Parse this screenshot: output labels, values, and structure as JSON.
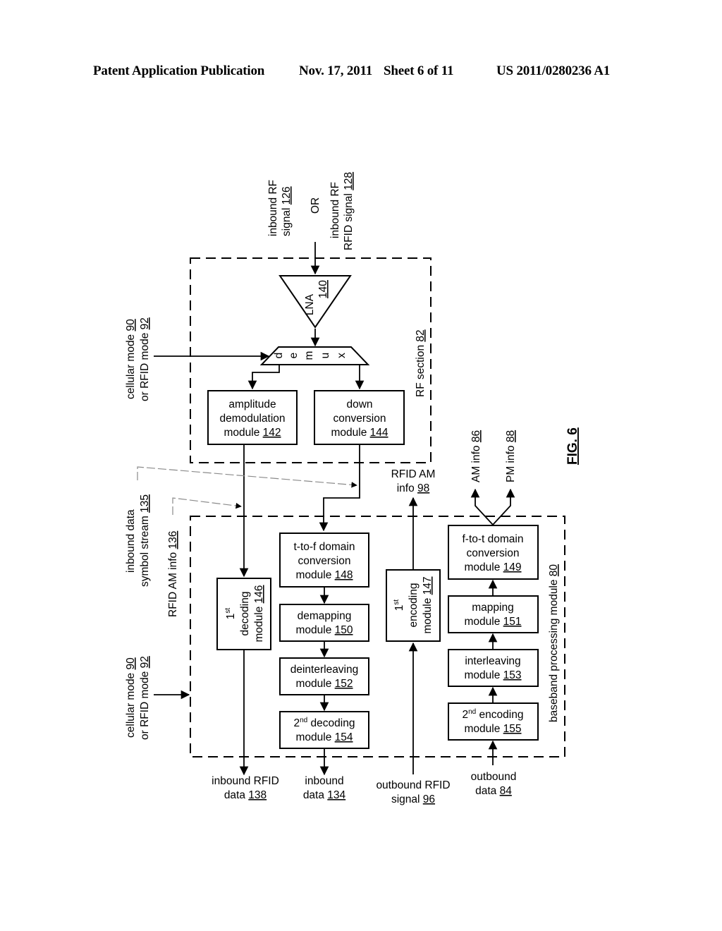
{
  "header": {
    "publication": "Patent Application Publication",
    "date": "Nov. 17, 2011",
    "sheet": "Sheet 6 of 11",
    "number": "US 2011/0280236 A1"
  },
  "figure": {
    "label": "FIG. 6",
    "inputs": {
      "inbound_rf": {
        "line1": "inbound RF",
        "line2_text": "signal ",
        "ref": "126"
      },
      "or": "OR",
      "inbound_rfid": {
        "line1": "inbound RF",
        "line2_text": "RFID signal ",
        "ref": "128"
      },
      "mode_top": {
        "line1_text": "cellular mode ",
        "ref1": "90",
        "line2_text": "or RFID mode ",
        "ref2": "92"
      },
      "mode_bottom": {
        "line1_text": "cellular mode ",
        "ref1": "90",
        "line2_text": "or RFID mode ",
        "ref2": "92"
      }
    },
    "rf_section": {
      "label_text": "RF section ",
      "ref": "82",
      "lna": {
        "label": "LNA",
        "ref": "140"
      },
      "demux": {
        "letters": [
          "d",
          "e",
          "m",
          "u",
          "x"
        ]
      },
      "amp_demod": {
        "line1": "amplitude",
        "line2": "demodulation",
        "line3_text": "module ",
        "ref": "142"
      },
      "down_conv": {
        "line1": "down",
        "line2": "conversion",
        "line3_text": "module ",
        "ref": "144"
      }
    },
    "leaders": {
      "inbound_stream": {
        "line1": "inbound data",
        "line2_text": "symbol stream ",
        "ref": "135"
      },
      "rfid_am_info": {
        "line1_text": "RFID AM info ",
        "ref": "136"
      }
    },
    "rfid_am_info_98": {
      "line1": "RFID AM",
      "line2_text": "info ",
      "ref": "98"
    },
    "am_info": {
      "text": "AM info ",
      "ref": "86"
    },
    "pm_info": {
      "text": "PM info ",
      "ref": "88"
    },
    "baseband": {
      "label_text": "baseband processing module ",
      "ref": "80",
      "decoding1": {
        "num": "1",
        "sup": "st",
        "line2": "decoding",
        "line3_text": "module ",
        "ref": "146"
      },
      "t_to_f": {
        "line1": "t-to-f domain",
        "line2": "conversion",
        "line3_text": "module ",
        "ref": "148"
      },
      "demapping": {
        "line1": "demapping",
        "line2_text": "module ",
        "ref": "150"
      },
      "deinterleaving": {
        "line1": "deinterleaving",
        "line2_text": "module ",
        "ref": "152"
      },
      "decoding2": {
        "num": "2",
        "sup": "nd",
        "line1_rest": " decoding",
        "line2_text": "module ",
        "ref": "154"
      },
      "encoding1": {
        "num": "1",
        "sup": "st",
        "line2": "encoding",
        "line3_text": "module ",
        "ref": "147"
      },
      "f_to_t": {
        "line1": "f-to-t domain",
        "line2": "conversion",
        "line3_text": "module ",
        "ref": "149"
      },
      "mapping": {
        "line1": "mapping",
        "line2_text": "module ",
        "ref": "151"
      },
      "interleaving": {
        "line1": "interleaving",
        "line2_text": "module ",
        "ref": "153"
      },
      "encoding2": {
        "num": "2",
        "sup": "nd",
        "line1_rest": " encoding",
        "line2_text": "module ",
        "ref": "155"
      }
    },
    "outputs": {
      "inbound_rfid_data": {
        "line1": "inbound RFID",
        "line2_text": "data ",
        "ref": "138"
      },
      "inbound_data": {
        "line1": "inbound",
        "line2_text": "data ",
        "ref": "134"
      },
      "outbound_rfid_signal": {
        "line1": "outbound RFID",
        "line2_text": "signal ",
        "ref": "96"
      },
      "outbound_data": {
        "line1": "outbound",
        "line2_text": "data ",
        "ref": "84"
      }
    }
  }
}
